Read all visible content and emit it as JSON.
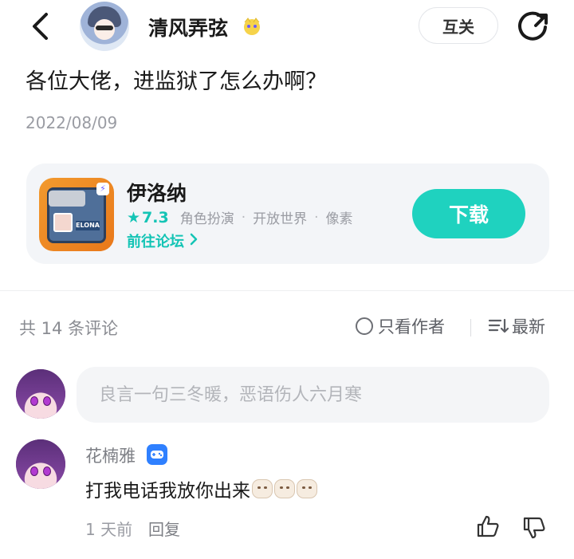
{
  "header": {
    "username": "清风弄弦",
    "follow_label": "互关"
  },
  "post": {
    "title": "各位大佬，进监狱了怎么办啊？",
    "date": "2022/08/09"
  },
  "game": {
    "name": "伊洛纳",
    "icon_tag": "ELONA",
    "rating": "7.3",
    "tags": [
      "角色扮演",
      "开放世界",
      "像素"
    ],
    "forum_link": "前往论坛",
    "download_label": "下载",
    "accent_color": "#1fd2bf"
  },
  "comments_bar": {
    "count_label": "共 14 条评论",
    "author_only_label": "只看作者",
    "sort_label": "最新"
  },
  "composer": {
    "placeholder": "良言一句三冬暖，恶语伤人六月寒"
  },
  "comment": {
    "author": "花楠雅",
    "text": "打我电话我放你出来",
    "emoji_count": 3,
    "time": "1 天前",
    "reply_label": "回复"
  }
}
